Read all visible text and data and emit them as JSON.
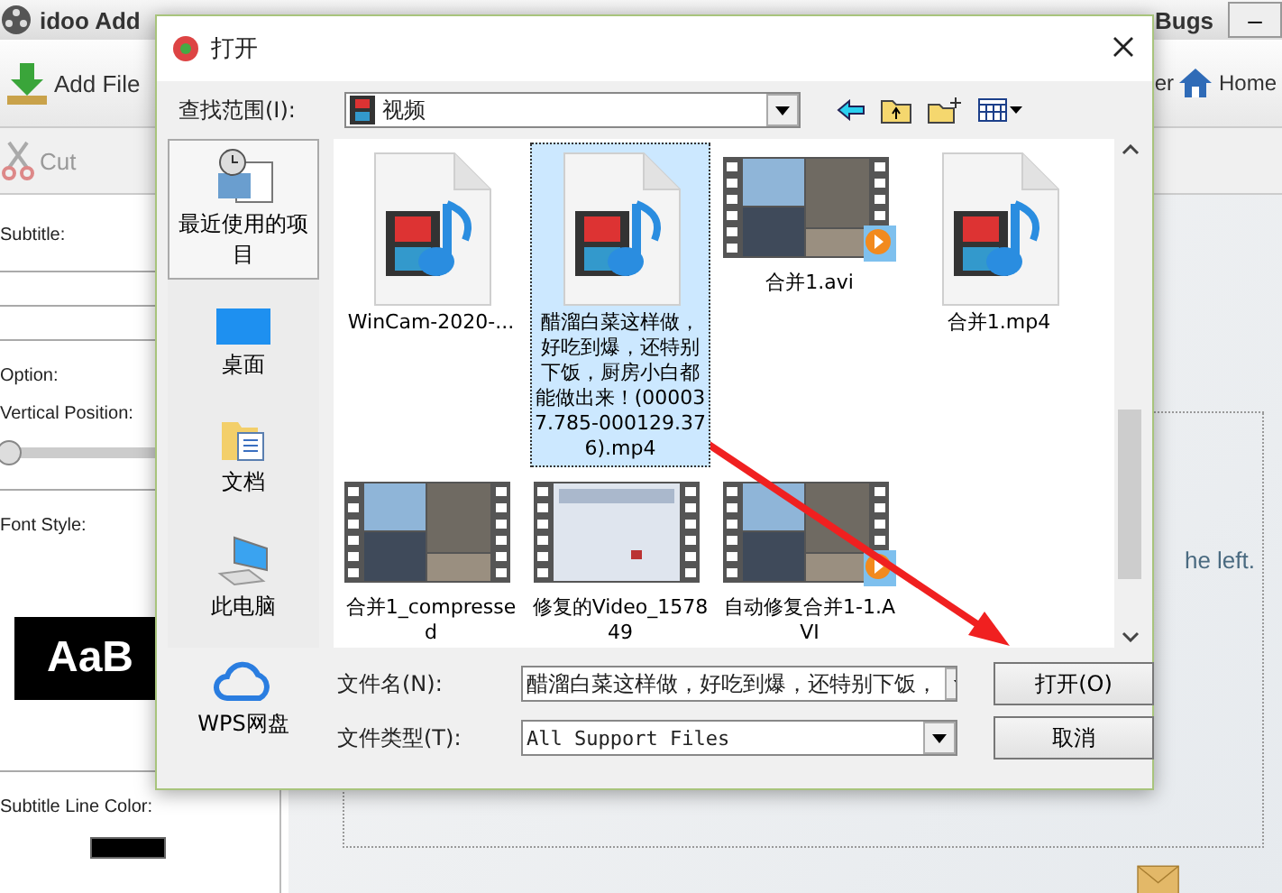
{
  "app": {
    "title": "idoo Add",
    "report": "Bugs",
    "minimize": "–",
    "add_file_button": "Add File",
    "partial_button": "er",
    "home_button": "Home",
    "cut_button": "Cut",
    "subtitle_label": "Subtitle:",
    "option_label": "Option:",
    "vertical_position_label": "Vertical Position:",
    "vertical_position_slider": {
      "level": 0
    },
    "font_style_label": "Font Style:",
    "font_preview": "AaB",
    "line_color_label": "Subtitle Line Color:",
    "hint_text": "he left."
  },
  "dialog": {
    "title": "打开",
    "look_in_label": "查找范围(I):",
    "look_in_value": "视频",
    "places": [
      {
        "label": "最近使用的项目",
        "selected": true
      },
      {
        "label": "桌面",
        "selected": false
      },
      {
        "label": "文档",
        "selected": false
      },
      {
        "label": "此电脑",
        "selected": false
      },
      {
        "label": "WPS网盘",
        "selected": false
      }
    ],
    "files": [
      {
        "name": "WinCam-2020-...",
        "kind": "media",
        "selected": false
      },
      {
        "name": "醋溜白菜这样做，好吃到爆，还特别下饭，厨房小白都能做出来！(000037.785-000129.376).mp4",
        "kind": "media",
        "selected": true
      },
      {
        "name": "合并1.avi",
        "kind": "player",
        "selected": false
      },
      {
        "name": "合并1.mp4",
        "kind": "media",
        "selected": false
      },
      {
        "name": "合并1_compressed",
        "kind": "video",
        "selected": false
      },
      {
        "name": "修复的Video_157849",
        "kind": "screen",
        "selected": false
      },
      {
        "name": "自动修复合并1-1.AVI",
        "kind": "player",
        "selected": false
      }
    ],
    "filename_label": "文件名(N):",
    "filename_value": "醋溜白菜这样做，好吃到爆，还特别下饭，",
    "filetype_label": "文件类型(T):",
    "filetype_value": "All Support Files",
    "open_button": "打开(O)",
    "cancel_button": "取消"
  }
}
